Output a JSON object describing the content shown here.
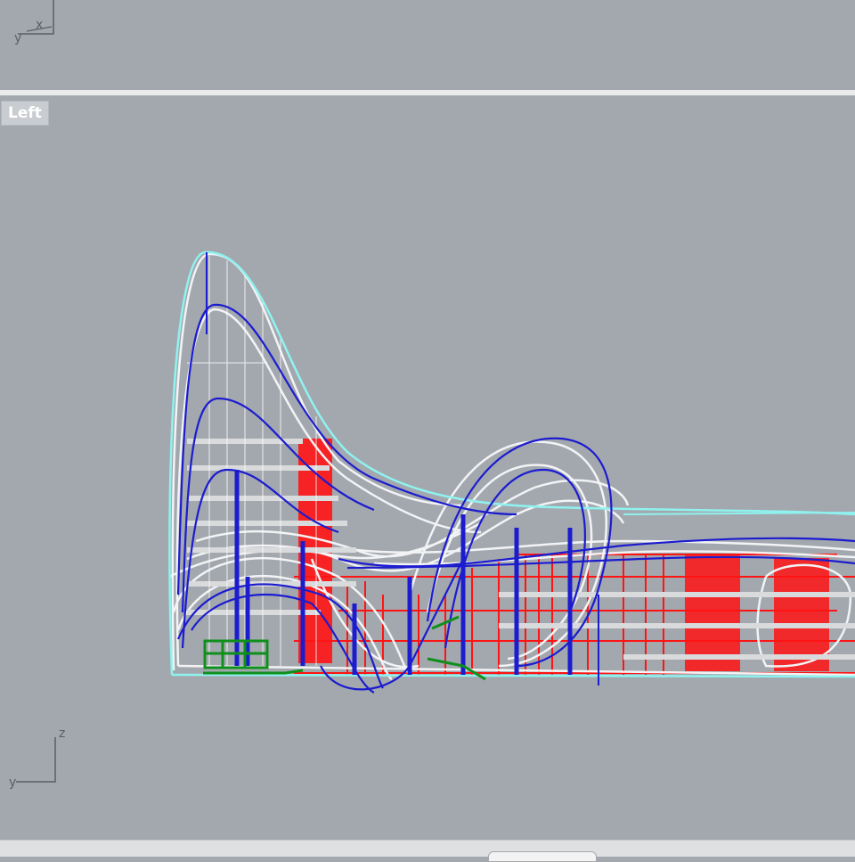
{
  "viewports": {
    "top_axis": {
      "label_a": "y",
      "label_b": "x"
    },
    "left": {
      "title": "Left",
      "axis": {
        "label_h": "y",
        "label_v": "z"
      }
    }
  },
  "colors": {
    "viewport_bg": "#a3a8ae",
    "curve_white": "#f2f3f5",
    "curve_blue": "#1c1ccf",
    "curve_cyan": "#8ff2ef",
    "curve_red": "#ff1414",
    "curve_green": "#0f8f1b"
  },
  "icons": [
    "axis-widget-icon",
    "axis-widget-icon"
  ]
}
